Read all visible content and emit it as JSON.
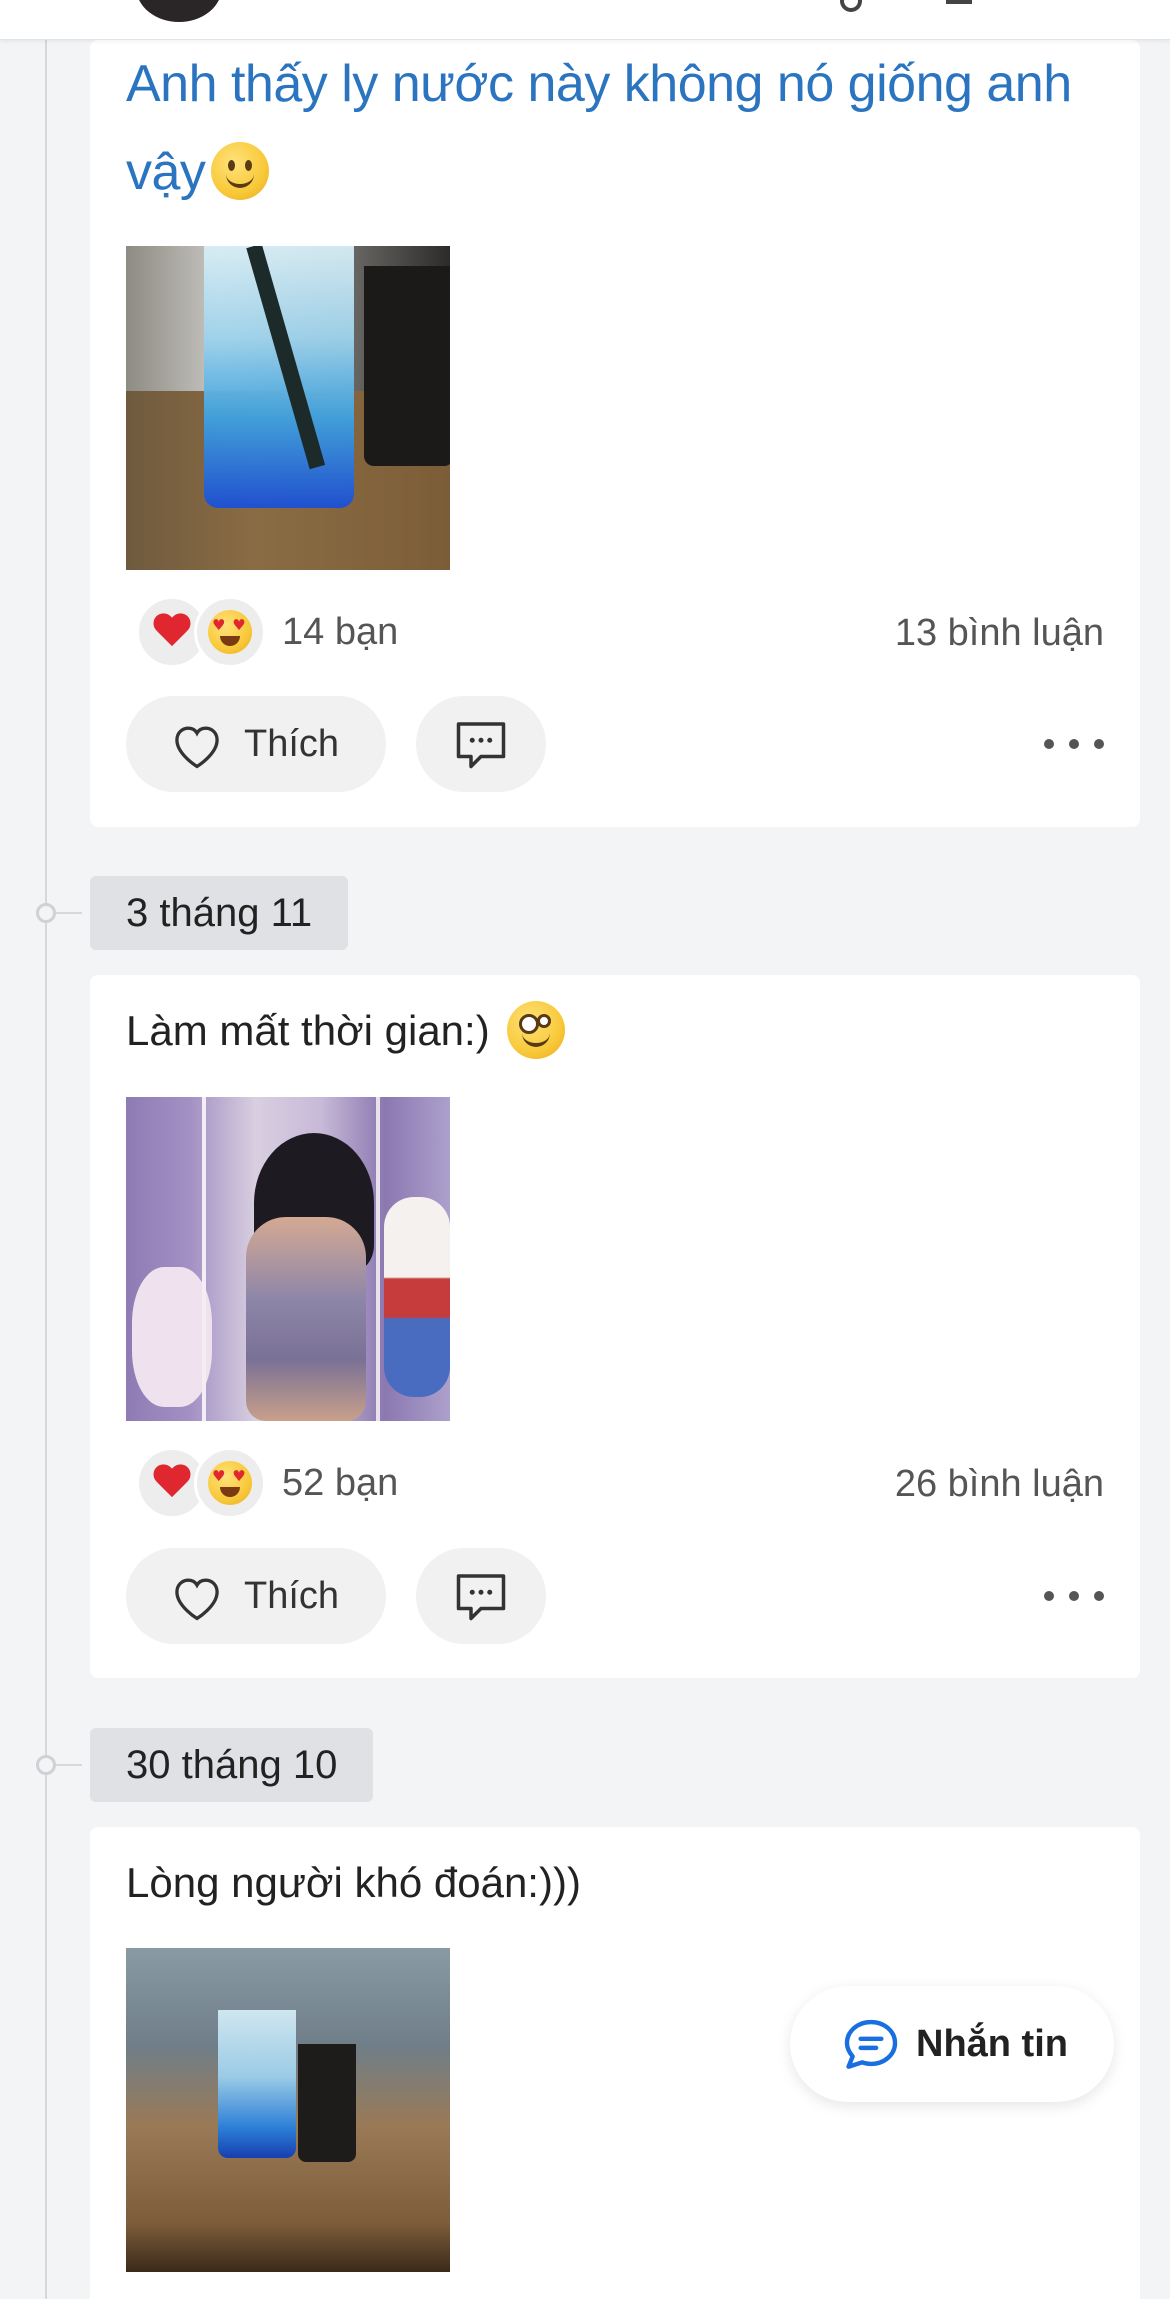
{
  "posts": [
    {
      "text": "Anh thấy ly nước này không nó giống anh vậy",
      "text_line1": "Anh thấy ly nước này không nó giống anh",
      "text_line2": "vậy",
      "text_emoji": "slightly-smiling-face-icon",
      "photo": "blue-drink-glass-photo",
      "reaction_icons": [
        "heart-icon",
        "heart-eyes-face-icon"
      ],
      "reaction_count": "14 bạn",
      "comment_count": "13 bình luận",
      "like_label": "Thích"
    },
    {
      "date": "3 tháng 11",
      "text": "Làm mất thời gian:)",
      "text_emoji": "rolling-eyes-face-icon",
      "photo": "mirror-selfie-photo",
      "reaction_icons": [
        "heart-icon",
        "heart-eyes-face-icon"
      ],
      "reaction_count": "52 bạn",
      "comment_count": "26 bình luận",
      "like_label": "Thích"
    },
    {
      "date": "30 tháng 10",
      "text": "Lòng người khó đoán:)))",
      "photo": "blue-drink-cafe-photo"
    }
  ],
  "fab": {
    "label": "Nhắn tin",
    "icon": "chat-bubble-icon"
  },
  "colors": {
    "background": "#f3f4f6",
    "card": "#ffffff",
    "styled_text": "#2a74c0",
    "chat_icon": "#1a6fe0",
    "heart": "#e0262f"
  }
}
